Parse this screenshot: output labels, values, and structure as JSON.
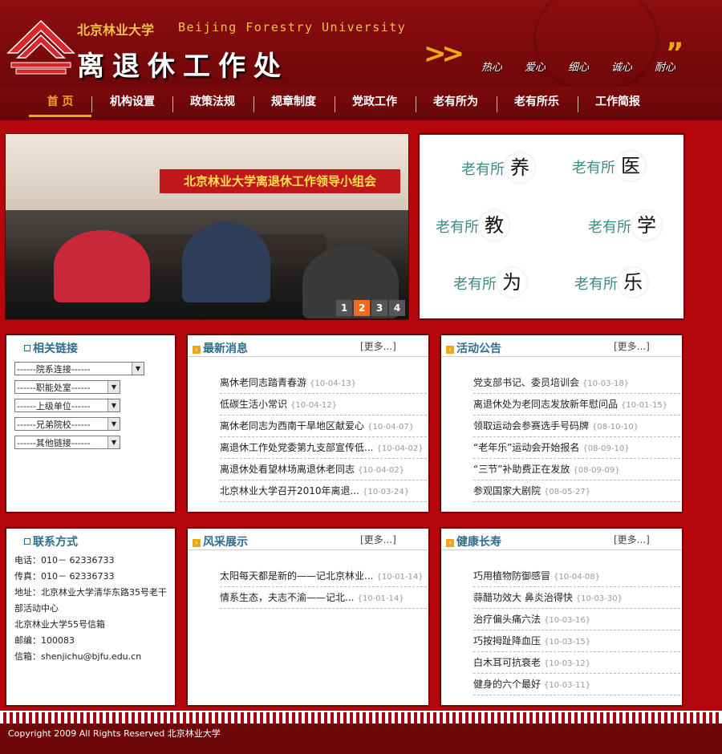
{
  "header": {
    "uni_name": "北京林业大学",
    "uni_en": "Beijing Forestry University",
    "dept": "离退休工作处",
    "slogans": [
      "热心",
      "爱心",
      "细心",
      "诚心",
      "耐心"
    ]
  },
  "nav": [
    "首 页",
    "机构设置",
    "政策法规",
    "规章制度",
    "党政工作",
    "老有所为",
    "老有所乐",
    "工作简报"
  ],
  "slider": {
    "banner": "北京林业大学离退休工作领导小组会",
    "pages": [
      "1",
      "2",
      "3",
      "4"
    ],
    "active_page": "2"
  },
  "laoyou": [
    {
      "prefix": "老有所",
      "char": "养"
    },
    {
      "prefix": "老有所",
      "char": "医"
    },
    {
      "prefix": "老有所",
      "char": "教"
    },
    {
      "prefix": "老有所",
      "char": "学"
    },
    {
      "prefix": "老有所",
      "char": "为"
    },
    {
      "prefix": "老有所",
      "char": "乐"
    }
  ],
  "links": {
    "title": "相关链接",
    "selects": [
      "------院系连接------",
      "------职能处室------",
      "------上级单位------",
      "------兄弟院校------",
      "------其他链接------"
    ]
  },
  "news": {
    "title": "最新消息",
    "more": "[更多...]",
    "items": [
      {
        "t": "离休老同志踏青春游",
        "d": "{10-04-13}"
      },
      {
        "t": "低碳生活小常识",
        "d": "{10-04-12}"
      },
      {
        "t": "离休老同志为西南干旱地区献爱心",
        "d": "{10-04-07}"
      },
      {
        "t": "离退休工作处党委第九支部宣传低...",
        "d": "{10-04-02}"
      },
      {
        "t": "离退休处看望林场离退休老同志",
        "d": "{10-04-02}"
      },
      {
        "t": "北京林业大学召开2010年离退...",
        "d": "{10-03-24}"
      }
    ]
  },
  "notices": {
    "title": "活动公告",
    "more": "[更多...]",
    "items": [
      {
        "t": "党支部书记、委员培训会",
        "d": "{10-03-18}"
      },
      {
        "t": "离退休处为老同志发放新年慰问品",
        "d": "{10-01-15}"
      },
      {
        "t": "领取运动会参赛选手号码牌",
        "d": "{08-10-10}"
      },
      {
        "t": "“老年乐”运动会开始报名",
        "d": "{08-09-10}"
      },
      {
        "t": "“三节”补助费正在发放",
        "d": "{08-09-09}"
      },
      {
        "t": "参观国家大剧院",
        "d": "{08-05-27}"
      }
    ]
  },
  "contact": {
    "title": "联系方式",
    "lines": [
      "电话：010－ 62336733",
      "传真：010－ 62336733",
      "地址：北京林业大学清华东路35号老干部活动中心",
      "北京林业大学55号信箱",
      "邮编：100083",
      "信箱：shenjichu@bjfu.edu.cn"
    ]
  },
  "style": {
    "title": "风采展示",
    "more": "[更多...]",
    "items": [
      {
        "t": "太阳每天都是新的——记北京林业...",
        "d": "{10-01-14}"
      },
      {
        "t": "情系生态，夫志不渝——记北...",
        "d": "{10-01-14}"
      }
    ]
  },
  "health": {
    "title": "健康长寿",
    "more": "[更多...]",
    "items": [
      {
        "t": "巧用植物防御感冒",
        "d": "{10-04-08}"
      },
      {
        "t": "蒜醋功效大 鼻炎治得快",
        "d": "{10-03-30}"
      },
      {
        "t": "治疗偏头痛六法",
        "d": "{10-03-16}"
      },
      {
        "t": "巧按拇趾降血压",
        "d": "{10-03-15}"
      },
      {
        "t": "白木耳可抗衰老",
        "d": "{10-03-12}"
      },
      {
        "t": "健身的六个最好",
        "d": "{10-03-11}"
      }
    ]
  },
  "footer": "Copyright 2009 All Rights Reserved 北京林业大学",
  "colors": {
    "brand_red": "#b5060b",
    "nav_dark": "#6e0709",
    "accent_orange": "#f6a21b",
    "title_blue": "#2f6e8c"
  }
}
